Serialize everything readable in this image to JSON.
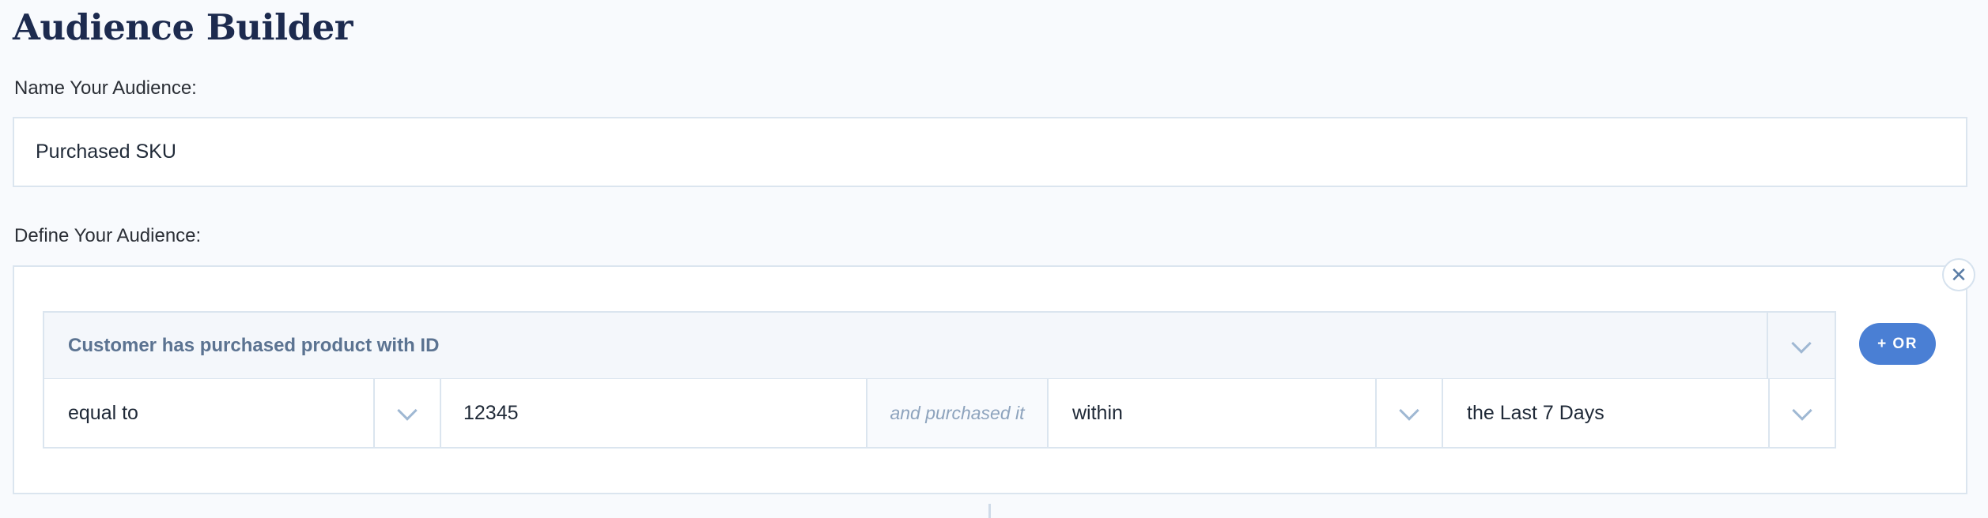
{
  "page": {
    "title": "Audience Builder"
  },
  "name_section": {
    "label": "Name Your Audience:",
    "value": "Purchased SKU"
  },
  "define_section": {
    "label": "Define Your Audience:",
    "close_glyph": "✕",
    "rule": {
      "condition": "Customer has purchased product with ID",
      "operator": "equal to",
      "product_id": "12345",
      "connector": "and purchased it",
      "time_qualifier": "within",
      "time_range": "the Last 7 Days"
    },
    "or_button": "+ OR"
  },
  "colors": {
    "accent": "#4a7fd4",
    "title": "#1d2b4f",
    "border": "#dbe5ef",
    "muted_text": "#8da3bd"
  }
}
